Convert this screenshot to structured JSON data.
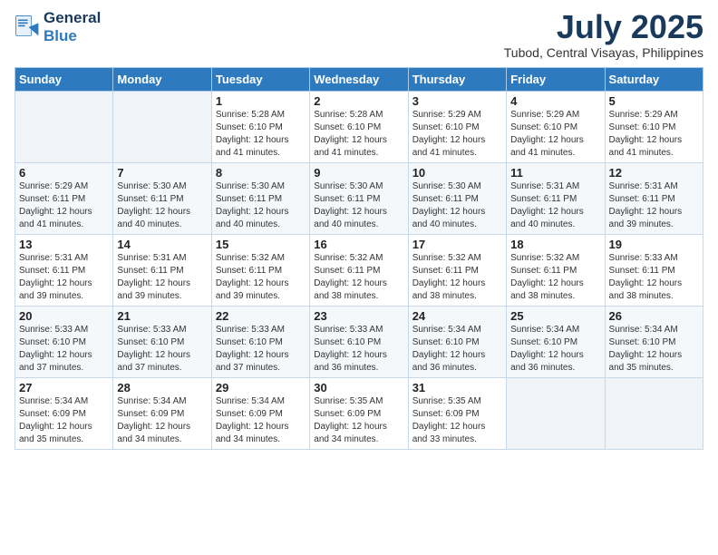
{
  "logo": {
    "line1": "General",
    "line2": "Blue"
  },
  "title": "July 2025",
  "location": "Tubod, Central Visayas, Philippines",
  "headers": [
    "Sunday",
    "Monday",
    "Tuesday",
    "Wednesday",
    "Thursday",
    "Friday",
    "Saturday"
  ],
  "weeks": [
    [
      {
        "day": "",
        "info": ""
      },
      {
        "day": "",
        "info": ""
      },
      {
        "day": "1",
        "info": "Sunrise: 5:28 AM\nSunset: 6:10 PM\nDaylight: 12 hours and 41 minutes."
      },
      {
        "day": "2",
        "info": "Sunrise: 5:28 AM\nSunset: 6:10 PM\nDaylight: 12 hours and 41 minutes."
      },
      {
        "day": "3",
        "info": "Sunrise: 5:29 AM\nSunset: 6:10 PM\nDaylight: 12 hours and 41 minutes."
      },
      {
        "day": "4",
        "info": "Sunrise: 5:29 AM\nSunset: 6:10 PM\nDaylight: 12 hours and 41 minutes."
      },
      {
        "day": "5",
        "info": "Sunrise: 5:29 AM\nSunset: 6:10 PM\nDaylight: 12 hours and 41 minutes."
      }
    ],
    [
      {
        "day": "6",
        "info": "Sunrise: 5:29 AM\nSunset: 6:11 PM\nDaylight: 12 hours and 41 minutes."
      },
      {
        "day": "7",
        "info": "Sunrise: 5:30 AM\nSunset: 6:11 PM\nDaylight: 12 hours and 40 minutes."
      },
      {
        "day": "8",
        "info": "Sunrise: 5:30 AM\nSunset: 6:11 PM\nDaylight: 12 hours and 40 minutes."
      },
      {
        "day": "9",
        "info": "Sunrise: 5:30 AM\nSunset: 6:11 PM\nDaylight: 12 hours and 40 minutes."
      },
      {
        "day": "10",
        "info": "Sunrise: 5:30 AM\nSunset: 6:11 PM\nDaylight: 12 hours and 40 minutes."
      },
      {
        "day": "11",
        "info": "Sunrise: 5:31 AM\nSunset: 6:11 PM\nDaylight: 12 hours and 40 minutes."
      },
      {
        "day": "12",
        "info": "Sunrise: 5:31 AM\nSunset: 6:11 PM\nDaylight: 12 hours and 39 minutes."
      }
    ],
    [
      {
        "day": "13",
        "info": "Sunrise: 5:31 AM\nSunset: 6:11 PM\nDaylight: 12 hours and 39 minutes."
      },
      {
        "day": "14",
        "info": "Sunrise: 5:31 AM\nSunset: 6:11 PM\nDaylight: 12 hours and 39 minutes."
      },
      {
        "day": "15",
        "info": "Sunrise: 5:32 AM\nSunset: 6:11 PM\nDaylight: 12 hours and 39 minutes."
      },
      {
        "day": "16",
        "info": "Sunrise: 5:32 AM\nSunset: 6:11 PM\nDaylight: 12 hours and 38 minutes."
      },
      {
        "day": "17",
        "info": "Sunrise: 5:32 AM\nSunset: 6:11 PM\nDaylight: 12 hours and 38 minutes."
      },
      {
        "day": "18",
        "info": "Sunrise: 5:32 AM\nSunset: 6:11 PM\nDaylight: 12 hours and 38 minutes."
      },
      {
        "day": "19",
        "info": "Sunrise: 5:33 AM\nSunset: 6:11 PM\nDaylight: 12 hours and 38 minutes."
      }
    ],
    [
      {
        "day": "20",
        "info": "Sunrise: 5:33 AM\nSunset: 6:10 PM\nDaylight: 12 hours and 37 minutes."
      },
      {
        "day": "21",
        "info": "Sunrise: 5:33 AM\nSunset: 6:10 PM\nDaylight: 12 hours and 37 minutes."
      },
      {
        "day": "22",
        "info": "Sunrise: 5:33 AM\nSunset: 6:10 PM\nDaylight: 12 hours and 37 minutes."
      },
      {
        "day": "23",
        "info": "Sunrise: 5:33 AM\nSunset: 6:10 PM\nDaylight: 12 hours and 36 minutes."
      },
      {
        "day": "24",
        "info": "Sunrise: 5:34 AM\nSunset: 6:10 PM\nDaylight: 12 hours and 36 minutes."
      },
      {
        "day": "25",
        "info": "Sunrise: 5:34 AM\nSunset: 6:10 PM\nDaylight: 12 hours and 36 minutes."
      },
      {
        "day": "26",
        "info": "Sunrise: 5:34 AM\nSunset: 6:10 PM\nDaylight: 12 hours and 35 minutes."
      }
    ],
    [
      {
        "day": "27",
        "info": "Sunrise: 5:34 AM\nSunset: 6:09 PM\nDaylight: 12 hours and 35 minutes."
      },
      {
        "day": "28",
        "info": "Sunrise: 5:34 AM\nSunset: 6:09 PM\nDaylight: 12 hours and 34 minutes."
      },
      {
        "day": "29",
        "info": "Sunrise: 5:34 AM\nSunset: 6:09 PM\nDaylight: 12 hours and 34 minutes."
      },
      {
        "day": "30",
        "info": "Sunrise: 5:35 AM\nSunset: 6:09 PM\nDaylight: 12 hours and 34 minutes."
      },
      {
        "day": "31",
        "info": "Sunrise: 5:35 AM\nSunset: 6:09 PM\nDaylight: 12 hours and 33 minutes."
      },
      {
        "day": "",
        "info": ""
      },
      {
        "day": "",
        "info": ""
      }
    ]
  ]
}
